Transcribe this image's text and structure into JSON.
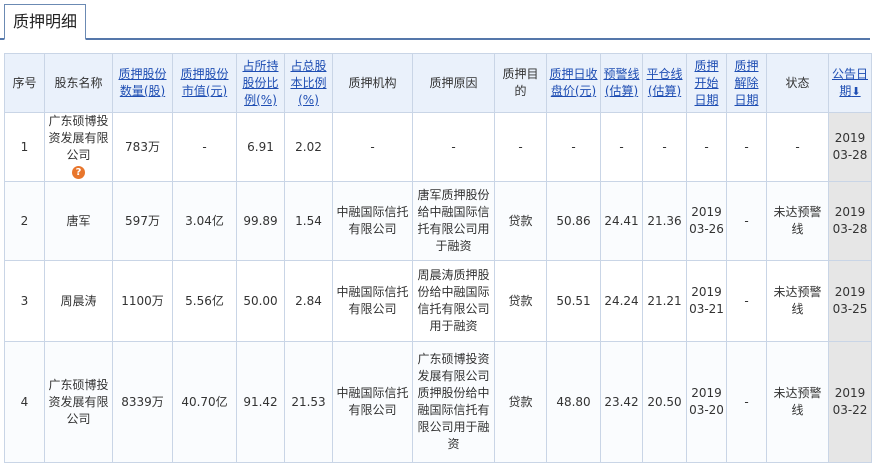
{
  "tab": {
    "title": "质押明细"
  },
  "headers": [
    {
      "label": "序号",
      "link": false
    },
    {
      "label": "股东名称",
      "link": false
    },
    {
      "label": "质押股份数量(股)",
      "link": true
    },
    {
      "label": "质押股份市值(元)",
      "link": true
    },
    {
      "label": "占所持股份比例(%)",
      "link": true
    },
    {
      "label": "占总股本比例(%)",
      "link": true
    },
    {
      "label": "质押机构",
      "link": false
    },
    {
      "label": "质押原因",
      "link": false
    },
    {
      "label": "质押目的",
      "link": false
    },
    {
      "label": "质押日收盘价(元)",
      "link": true
    },
    {
      "label": "预警线(估算)",
      "link": true
    },
    {
      "label": "平仓线(估算)",
      "link": true
    },
    {
      "label": "质押开始日期",
      "link": true
    },
    {
      "label": "质押解除日期",
      "link": true
    },
    {
      "label": "状态",
      "link": false
    },
    {
      "label": "公告日期",
      "link": true
    }
  ],
  "rows": [
    {
      "index": "1",
      "holder": "广东硕博投资发展有限公司",
      "shares": "783万",
      "value": "-",
      "pct_held": "6.91",
      "pct_total": "2.02",
      "institution": "-",
      "reason": "-",
      "purpose": "-",
      "close_price": "-",
      "warn_line": "-",
      "liquidation_line": "-",
      "start_date": "-",
      "release_date": "-",
      "status": "-",
      "announce_date": "2019 03-28",
      "has_warn_icon": true
    },
    {
      "index": "2",
      "holder": "唐军",
      "shares": "597万",
      "value": "3.04亿",
      "pct_held": "99.89",
      "pct_total": "1.54",
      "institution": "中融国际信托有限公司",
      "reason": "唐军质押股份给中融国际信托有限公司用于融资",
      "purpose": "贷款",
      "close_price": "50.86",
      "warn_line": "24.41",
      "liquidation_line": "21.36",
      "start_date": "2019 03-26",
      "release_date": "-",
      "status": "未达预警线",
      "announce_date": "2019 03-28",
      "has_warn_icon": false
    },
    {
      "index": "3",
      "holder": "周晨涛",
      "shares": "1100万",
      "value": "5.56亿",
      "pct_held": "50.00",
      "pct_total": "2.84",
      "institution": "中融国际信托有限公司",
      "reason": "周晨涛质押股份给中融国际信托有限公司用于融资",
      "purpose": "贷款",
      "close_price": "50.51",
      "warn_line": "24.24",
      "liquidation_line": "21.21",
      "start_date": "2019 03-21",
      "release_date": "-",
      "status": "未达预警线",
      "announce_date": "2019 03-25",
      "has_warn_icon": false
    },
    {
      "index": "4",
      "holder": "广东硕博投资发展有限公司",
      "shares": "8339万",
      "value": "40.70亿",
      "pct_held": "91.42",
      "pct_total": "21.53",
      "institution": "中融国际信托有限公司",
      "reason": "广东硕博投资发展有限公司质押股份给中融国际信托有限公司用于融资",
      "purpose": "贷款",
      "close_price": "48.80",
      "warn_line": "23.42",
      "liquidation_line": "20.50",
      "start_date": "2019 03-20",
      "release_date": "-",
      "status": "未达预警线",
      "announce_date": "2019 03-22",
      "has_warn_icon": false
    }
  ]
}
